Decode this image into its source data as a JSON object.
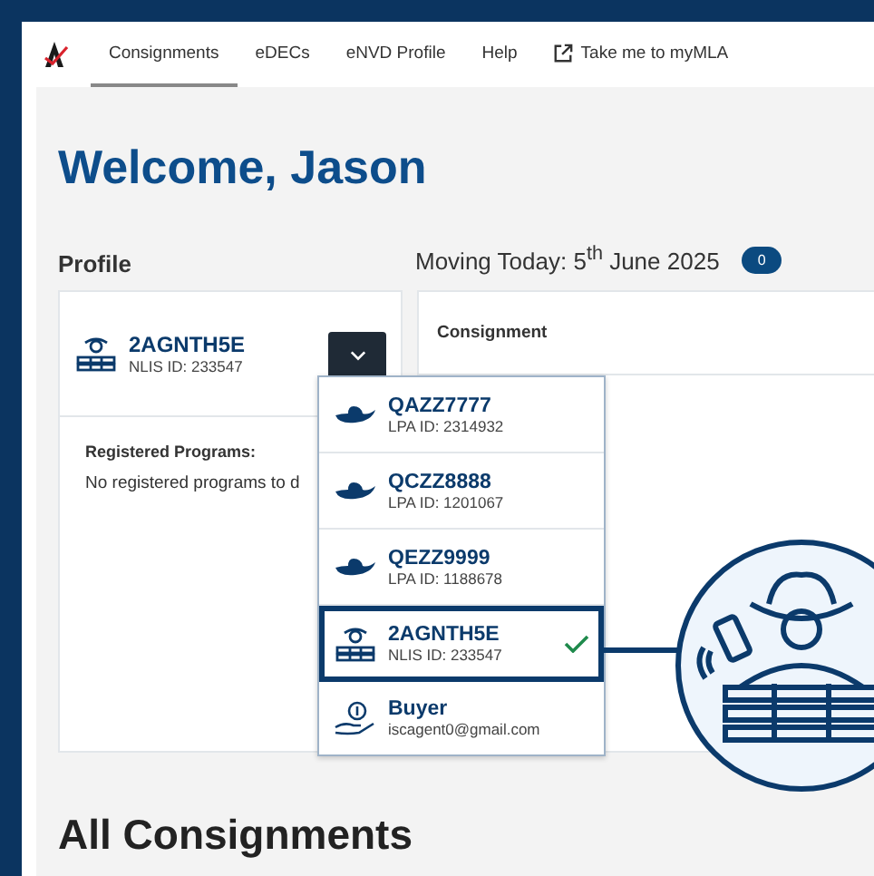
{
  "nav": {
    "tabs": [
      {
        "label": "Consignments",
        "selected": true,
        "kind": "page"
      },
      {
        "label": "eDECs",
        "selected": false,
        "kind": "page"
      },
      {
        "label": "eNVD Profile",
        "selected": false,
        "kind": "page"
      },
      {
        "label": "Help",
        "selected": false,
        "kind": "page"
      },
      {
        "label": "Take me to myMLA",
        "selected": false,
        "kind": "external"
      }
    ]
  },
  "heading": "Welcome, Jason",
  "profile": {
    "label": "Profile",
    "name": "2AGNTH5E",
    "id": "NLIS ID: 233547",
    "kind": "agent",
    "programs_label": "Registered Programs:",
    "programs_text": "No registered programs to d"
  },
  "moving": {
    "text": "Moving Today: 5$^{th}$ June 2025",
    "count": "0"
  },
  "consignment": {
    "title": "Consignment"
  },
  "dropdown": {
    "items": [
      {
        "kind": "producer",
        "name": "QAZZ7777",
        "id": "LPA ID: 2314932",
        "selected": false
      },
      {
        "kind": "producer",
        "name": "QCZZ8888",
        "id": "LPA ID: 1201067",
        "selected": false
      },
      {
        "kind": "producer",
        "name": "QEZZ9999",
        "id": "LPA ID: 1188678",
        "selected": false
      },
      {
        "kind": "agent",
        "name": "2AGNTH5E",
        "id": "NLIS ID: 233547",
        "selected": true
      },
      {
        "kind": "buyer",
        "name": "Buyer",
        "id": "iscagent0@gmail.com",
        "selected": false
      }
    ]
  },
  "section_title": "All Consignments"
}
